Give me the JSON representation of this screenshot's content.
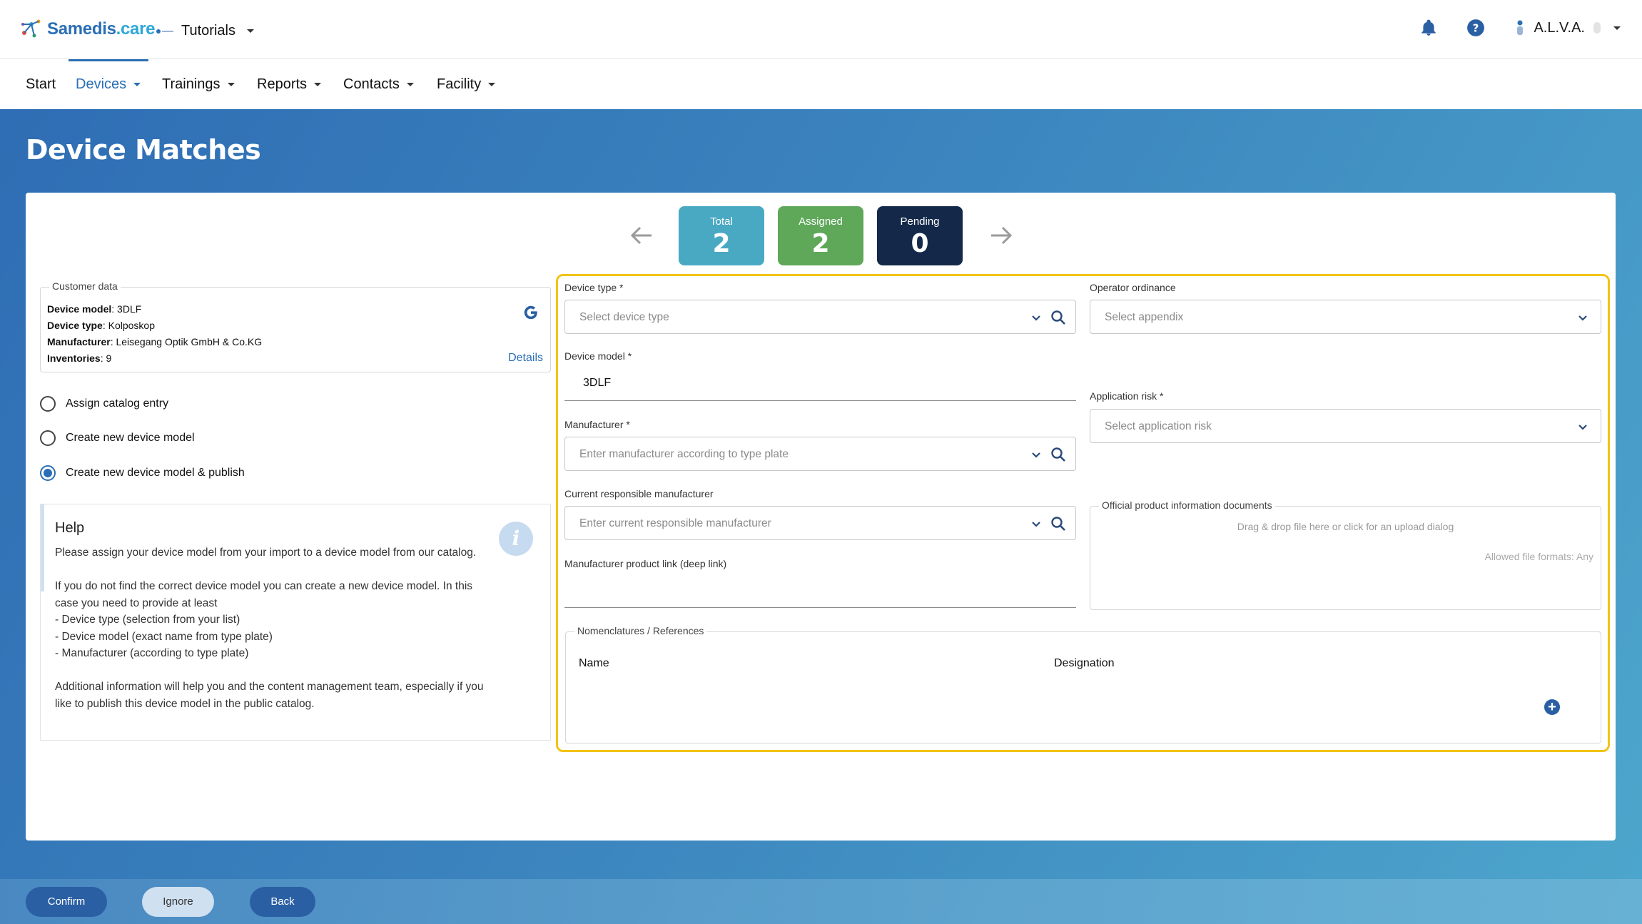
{
  "brand": {
    "name_main": "Samedis",
    "name_suffix": ".care"
  },
  "tenant": {
    "name": "Tutorials"
  },
  "user": {
    "name": "A.L.V.A."
  },
  "nav": {
    "items": [
      {
        "label": "Start"
      },
      {
        "label": "Devices"
      },
      {
        "label": "Trainings"
      },
      {
        "label": "Reports"
      },
      {
        "label": "Contacts"
      },
      {
        "label": "Facility"
      }
    ]
  },
  "page": {
    "title": "Device Matches"
  },
  "counters": {
    "total": {
      "label": "Total",
      "value": "2",
      "color": "#49a9c3"
    },
    "assigned": {
      "label": "Assigned",
      "value": "2",
      "color": "#5fa85a"
    },
    "pending": {
      "label": "Pending",
      "value": "0",
      "color": "#14294a"
    }
  },
  "customer": {
    "legend": "Customer data",
    "device_model_label": "Device model",
    "device_model": ": 3DLF",
    "device_type_label": "Device type",
    "device_type": ": Kolposkop",
    "manufacturer_label": "Manufacturer",
    "manufacturer": ": Leisegang Optik GmbH & Co.KG",
    "inventories_label": "Inventories",
    "inventories": ": 9",
    "details_link": "Details"
  },
  "options": {
    "assign": "Assign catalog entry",
    "create": "Create new device model",
    "create_publish": "Create new device model & publish"
  },
  "help": {
    "title": "Help",
    "text": "Please assign your device model from your import to a device model from our catalog.\n\nIf you do not find the correct device model you can create a new device model. In this case you need to provide at least\n- Device type (selection from your list)\n- Device model (exact name from type plate)\n- Manufacturer (according to type plate)\n\nAdditional information will help you and the content management team, especially if you like to publish this device model in the public catalog."
  },
  "form": {
    "device_type": {
      "label": "Device type *",
      "placeholder": "Select device type"
    },
    "device_model": {
      "label": "Device model *",
      "value": "3DLF"
    },
    "manufacturer": {
      "label": "Manufacturer *",
      "placeholder": "Enter manufacturer according to type plate"
    },
    "current_manufacturer": {
      "label": "Current responsible manufacturer",
      "placeholder": "Enter current responsible manufacturer"
    },
    "product_link": {
      "label": "Manufacturer product link (deep link)"
    },
    "operator_ordinance": {
      "label": "Operator ordinance",
      "placeholder": "Select appendix"
    },
    "application_risk": {
      "label": "Application risk *",
      "placeholder": "Select application risk"
    },
    "documents": {
      "legend": "Official product information documents",
      "drop_text": "Drag & drop file here or click for an upload dialog",
      "formats": "Allowed file formats: Any"
    },
    "nomenclatures": {
      "legend": "Nomenclatures / References",
      "col_name": "Name",
      "col_designation": "Designation"
    }
  },
  "actions": {
    "confirm": "Confirm",
    "ignore": "Ignore",
    "back": "Back"
  }
}
